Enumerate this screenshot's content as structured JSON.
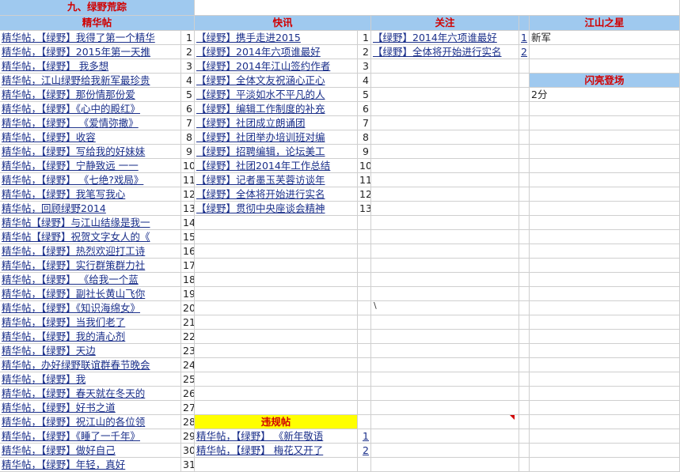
{
  "title": "九、绿野荒踪",
  "headers": {
    "essence": "精华帖",
    "news": "快讯",
    "attention": "关注",
    "star": "江山之星",
    "shine": "闪亮登场",
    "violation": "违规帖"
  },
  "essence_posts": [
    "精华帖，【绿野】我得了第一个精华",
    "精华帖，【绿野】2015年第一天推",
    "精华帖，【绿野】  我多想",
    "精华帖，江山绿野给我新军最珍贵",
    "精华帖，【绿野】那份情那份爱",
    "精华帖，【绿野】《心中的殿红》",
    "精华帖，【绿野】  《爱情弥撒》",
    "精华帖，【绿野】收容",
    "精华帖，【绿野】写给我的好妹妹",
    "精华帖，【绿野】宁静致远  一一",
    "精华帖，【绿野】  《七绝?戏局》",
    "精华帖，【绿野】我笔写我心",
    "精华帖，回顾绿野2014",
    "精华帖【绿野】与江山结缘是我一",
    "精华帖【绿野】祝贺文字女人的《",
    "精华帖，【绿野】热烈欢迎打工诗",
    "精华帖，【绿野】实行群策群力社",
    "精华帖，【绿野】  《给我一个蓝",
    "精华帖，【绿野】副社长黄山飞你",
    "精华帖，【绿野】《知识海绵女》",
    "精华帖，【绿野】当我们老了",
    "精华帖，【绿野】我的清心剂",
    "精华帖，【绿野】天边",
    "精华帖，办好绿野联谊群春节晚会",
    "精华帖，【绿野】我",
    "精华帖，【绿野】春天就在冬天的",
    "精华帖，【绿野】好书之道",
    "精华帖，【绿野】祝江山的各位领",
    "精华帖，【绿野】《睡了一千年》",
    "精华帖，【绿野】做好自己",
    "精华帖，【绿野】年轻，真好"
  ],
  "news_items": [
    "【绿野】携手走进2015",
    "【绿野】2014年六项谁最好",
    "【绿野】2014年江山签约作者",
    "【绿野】全体文友祝涵心正心",
    "【绿野】平淡如水不平凡的人",
    "【绿野】编辑工作制度的补充",
    "【绿野】社团成立朗诵团",
    "【绿野】社团举办培训班对编",
    "【绿野】招聘编辑，论坛美工",
    "【绿野】社团2014年工作总结",
    "【绿野】记者墨玉芙蓉访谈年",
    "【绿野】全体将开始进行实名",
    "【绿野】贯彻中央座谈会精神"
  ],
  "attention_items": [
    "【绿野】2014年六项谁最好",
    "【绿野】全体将开始进行实名"
  ],
  "star_items": [
    "新军"
  ],
  "shine_items": [
    "2分"
  ],
  "violation_items": [
    "精华帖，【绿野】  《新年敬语",
    "精华帖，【绿野】  梅花又开了"
  ],
  "stray_mark": "\\"
}
